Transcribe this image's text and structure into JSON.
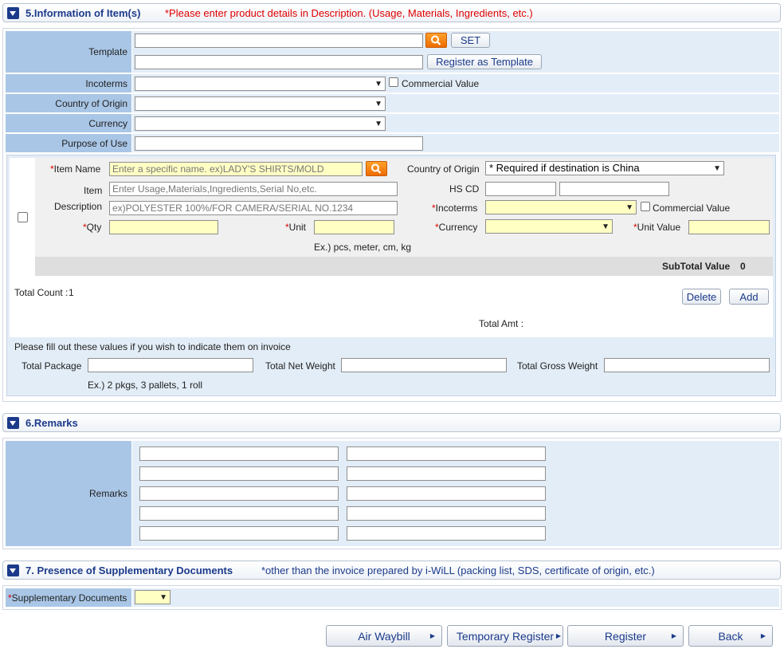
{
  "section5": {
    "title": "5.Information of Item(s)",
    "note": "*Please enter product details in Description. (Usage, Materials, Ingredients, etc.)",
    "template_label": "Template",
    "set_button": "SET",
    "register_template_button": "Register as Template",
    "incoterms_label": "Incoterms",
    "commercial_value_label": "Commercial Value",
    "country_label": "Country of Origin",
    "currency_label": "Currency",
    "purpose_label": "Purpose of Use",
    "item": {
      "item_name_label": "Item Name",
      "item_name_placeholder": "Enter a specific name. ex)LADY'S SHIRTS/MOLD",
      "country_label": "Country of Origin",
      "country_value": "* Required if destination is China",
      "item_label": "Item",
      "item_placeholder": "Enter Usage,Materials,Ingredients,Serial No,etc.",
      "hscd_label": "HS CD",
      "description_label": "Description",
      "description_placeholder": "ex)POLYESTER 100%/FOR CAMERA/SERIAL NO.1234",
      "incoterms_label": "Incoterms",
      "commercial_value_label": "Commercial Value",
      "qty_label": "Qty",
      "unit_label": "Unit",
      "currency_label": "Currency",
      "unit_value_label": "Unit Value",
      "unit_example": "Ex.) pcs, meter, cm, kg",
      "subtotal_label": "SubTotal Value",
      "subtotal_value": "0"
    },
    "total_count_label": "Total Count :",
    "total_count_value": "1",
    "delete_button": "Delete",
    "add_button": "Add",
    "total_amt_label": "Total Amt :",
    "invoice_note": "Please fill out these values if you wish to indicate them on invoice",
    "total_package_label": "Total Package",
    "total_net_weight_label": "Total Net Weight",
    "total_gross_weight_label": "Total Gross Weight",
    "package_example": "Ex.) 2 pkgs, 3 pallets, 1 roll"
  },
  "section6": {
    "title": "6.Remarks",
    "remarks_label": "Remarks"
  },
  "section7": {
    "title": "7. Presence of Supplementary Documents",
    "note": "*other than the invoice prepared by i-WiLL (packing list, SDS, certificate of origin, etc.)",
    "supp_label": "Supplementary Documents"
  },
  "footer": {
    "air_waybill": "Air Waybill",
    "temporary_register": "Temporary Register",
    "register": "Register",
    "back": "Back"
  },
  "colors": {
    "label_bg": "#a9c6e6",
    "value_bg": "#e3edf7",
    "required_yellow": "#ffffc4",
    "accent_blue": "#1b3a8a",
    "required_red": "#e00000",
    "search_orange": "#f28a14"
  }
}
